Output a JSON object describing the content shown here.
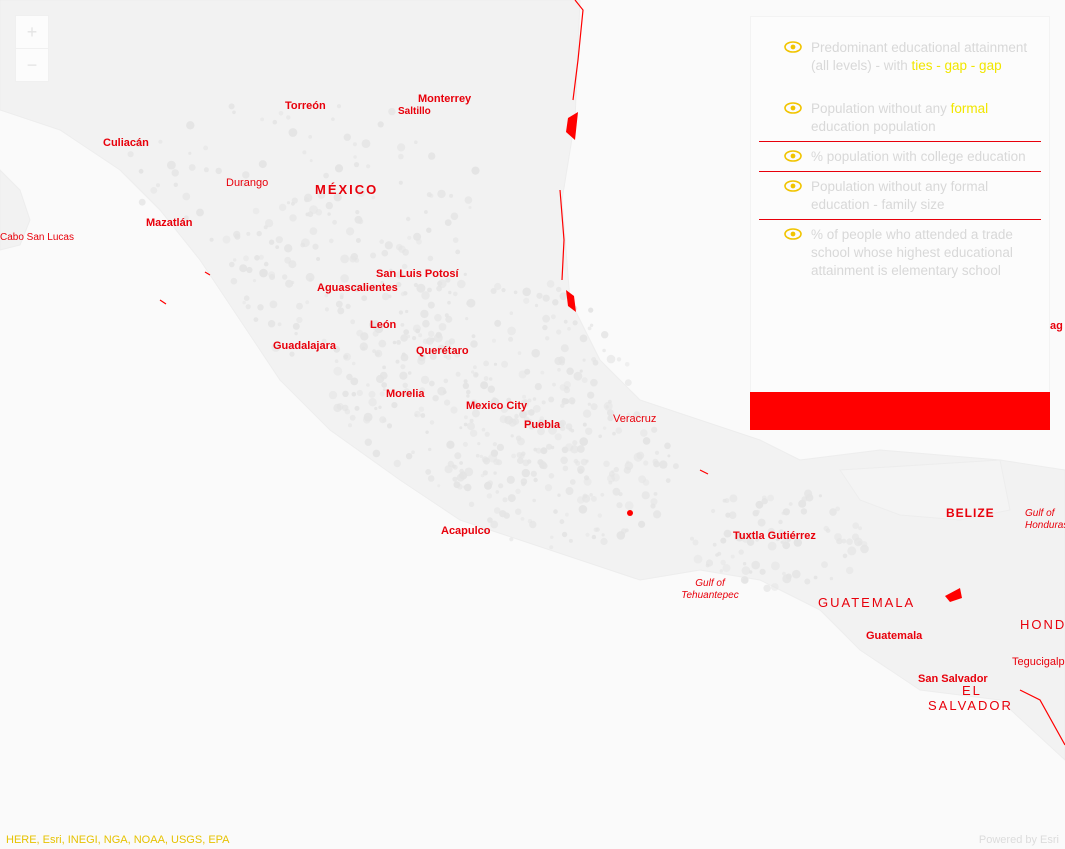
{
  "zoom": {
    "in": "+",
    "out": "−"
  },
  "labels": {
    "torreon": "Torreón",
    "monterrey": "Monterrey",
    "saltillo": "Saltillo",
    "culiacan": "Culiacán",
    "durango": "Durango",
    "mexico": "MÉXICO",
    "mazatlan": "Mazatlán",
    "cabo": "Cabo San Lucas",
    "san_luis": "San Luis Potosí",
    "aguascalientes": "Aguascalientes",
    "leon": "León",
    "guadalajara": "Guadalajara",
    "queretaro": "Querétaro",
    "morelia": "Morelia",
    "mexico_city": "Mexico City",
    "puebla": "Puebla",
    "veracruz": "Veracruz",
    "acapulco": "Acapulco",
    "tuxtla": "Tuxtla Gutiérrez",
    "gulf": "Gulf of Tehuantepec",
    "belize": "BELIZE",
    "gulf_hond": "Gulf of Honduras",
    "guatemala": "GUATEMALA",
    "guatemala_city": "Guatemala",
    "hond": "HOND",
    "tegucigalpa": "Tegucigalpa",
    "san_salvador": "San Salvador",
    "el": "EL",
    "salvador": "SALVADOR",
    "edge_label": "ag"
  },
  "layers": [
    {
      "pre": "Predominant educational attainment (all levels) - with ",
      "hl": "ties - gap - gap"
    },
    {
      "pre": "Population without any ",
      "hl": "formal",
      "post": " education population"
    },
    {
      "pre": "% population with college education",
      "hl": "",
      "post": ""
    },
    {
      "pre": "Population without any formal education - family size",
      "hl": "",
      "post": ""
    },
    {
      "pre": "% of people who attended a trade school whose highest educational attainment is elementary school",
      "hl": "",
      "post": ""
    }
  ],
  "attribution": {
    "source": "HERE, Esri, INEGI, NGA, NOAA, USGS, EPA",
    "powered": "Powered by Esri"
  },
  "colors": {
    "label": "#e8000b",
    "highlight": "#f1e600",
    "land": "#efefef",
    "dots": "#e2e2e2"
  }
}
